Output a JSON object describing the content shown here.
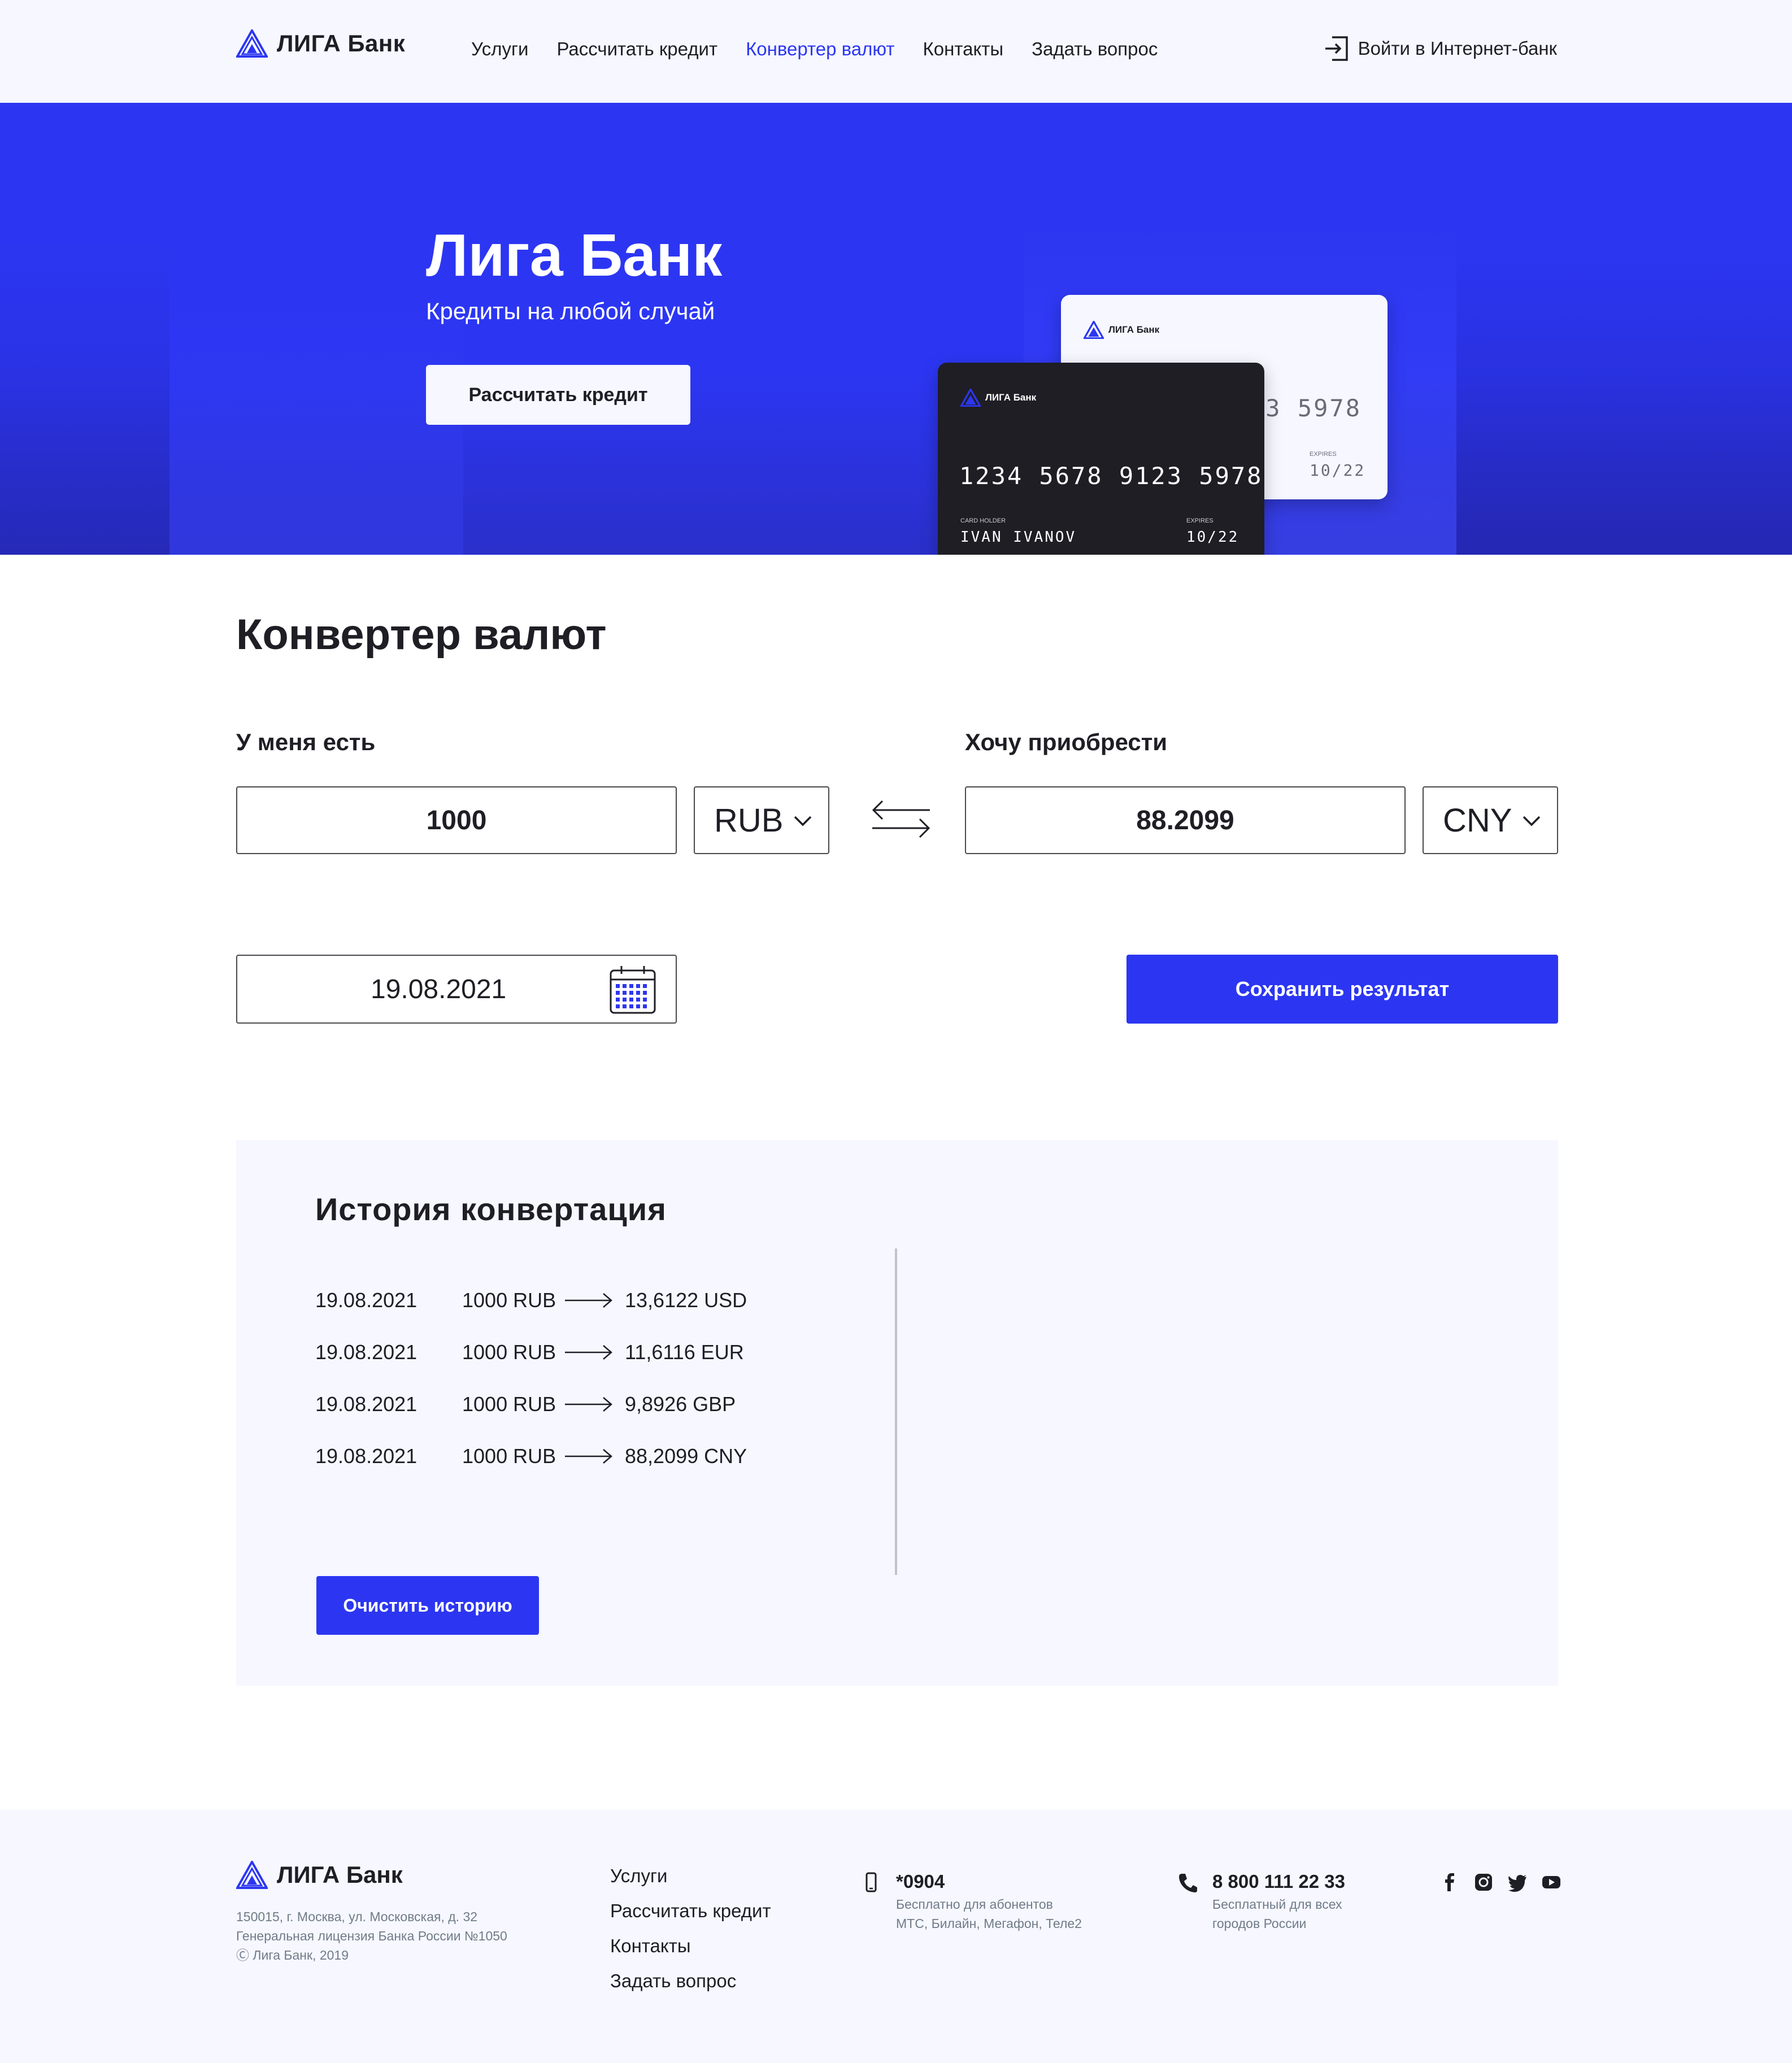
{
  "brand": {
    "name": "ЛИГА Банк",
    "accent": "#2c36f2",
    "dark": "#1f1e25",
    "light_bg": "#f6f7ff"
  },
  "header": {
    "nav": [
      {
        "label": "Услуги",
        "active": false
      },
      {
        "label": "Рассчитать кредит",
        "active": false
      },
      {
        "label": "Конвертер валют",
        "active": true
      },
      {
        "label": "Контакты",
        "active": false
      },
      {
        "label": "Задать вопрос",
        "active": false
      }
    ],
    "login_label": "Войти в Интернет-банк",
    "login_icon": "login-icon"
  },
  "hero": {
    "title": "Лига Банк",
    "subtitle": "Кредиты на любой случай",
    "button_label": "Рассчитать кредит",
    "card_front": {
      "logo": "ЛИГА Банк",
      "number": "1234 5678 9123 5978",
      "holder_label": "CARD HOLDER",
      "holder": "IVAN IVANOV",
      "expires_label": "EXPIRES",
      "expires": "10/22"
    },
    "card_back": {
      "logo": "ЛИГА Банк",
      "number_partial": "23 5978",
      "expires_label": "EXPIRES",
      "expires": "10/22"
    }
  },
  "converter": {
    "title": "Конвертер валют",
    "have_label": "У меня есть",
    "want_label": "Хочу приобрести",
    "have_amount": "1000",
    "have_currency": "RUB",
    "want_amount": "88.2099",
    "want_currency": "CNY",
    "date": "19.08.2021",
    "save_label": "Сохранить результат"
  },
  "history": {
    "title": "История конвертация",
    "rows": [
      {
        "date": "19.08.2021",
        "from": "1000 RUB",
        "to": "13,6122 USD"
      },
      {
        "date": "19.08.2021",
        "from": "1000 RUB",
        "to": "11,6116 EUR"
      },
      {
        "date": "19.08.2021",
        "from": "1000 RUB",
        "to": "9,8926 GBP"
      },
      {
        "date": "19.08.2021",
        "from": "1000 RUB",
        "to": "88,2099 CNY"
      }
    ],
    "clear_label": "Очистить историю"
  },
  "footer": {
    "logo": "ЛИГА Банк",
    "address": [
      "150015, г. Москва, ул. Московская, д. 32",
      "Генеральная лицензия Банка России №1050",
      "Ⓒ Лига Банк, 2019"
    ],
    "nav": [
      "Услуги",
      "Рассчитать кредит",
      "Контакты",
      "Задать вопрос"
    ],
    "contacts": [
      {
        "icon": "mobile-icon",
        "number": "*0904",
        "note": [
          "Бесплатно для абонентов",
          "МТС, Билайн, Мегафон, Теле2"
        ]
      },
      {
        "icon": "phone-icon",
        "number": "8 800 111 22 33",
        "note": [
          "Бесплатный для всех",
          "городов России"
        ]
      }
    ],
    "socials": [
      "facebook-icon",
      "instagram-icon",
      "twitter-icon",
      "youtube-icon"
    ]
  }
}
